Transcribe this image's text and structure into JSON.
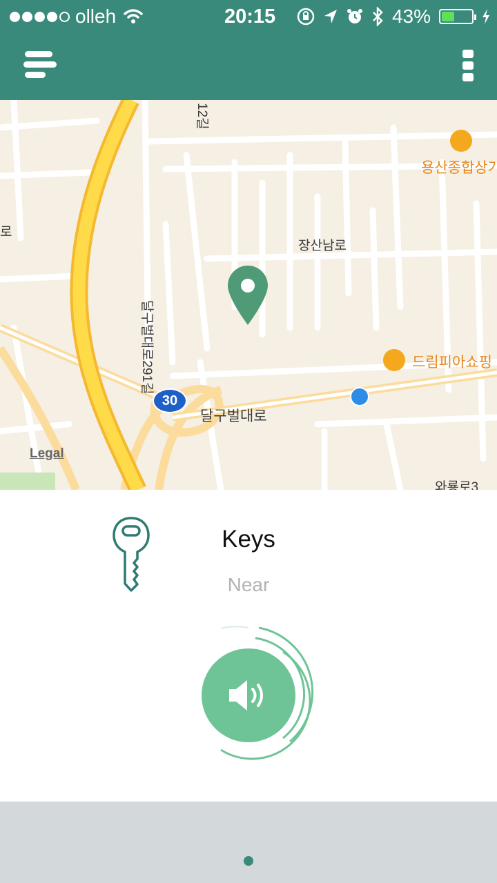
{
  "status_bar": {
    "carrier": "olleh",
    "time": "20:15",
    "battery_percent": "43%",
    "battery_level": 0.43,
    "signal_bars": 4
  },
  "header": {
    "menu_icon": "menu-icon",
    "more_icon": "more-vertical-icon",
    "background_color": "#3a8a7b"
  },
  "map": {
    "labels": {
      "road_a": "달구벌대로291길",
      "road_b": "달구벌대로",
      "road_c": "장산남로",
      "road_d": "12길",
      "road_e": "와룡로3",
      "edge": "로",
      "poi_a": "용산종합상가",
      "poi_b": "드림피아쇼핑",
      "route_number": "30"
    },
    "legal": "Legal",
    "pin_icon": "map-pin-icon"
  },
  "device": {
    "name": "Keys",
    "status": "Near",
    "icon": "key-icon",
    "sound_icon": "speaker-icon",
    "accent_color": "#6fc497"
  },
  "pager": {
    "pages": 1,
    "active": 1
  }
}
